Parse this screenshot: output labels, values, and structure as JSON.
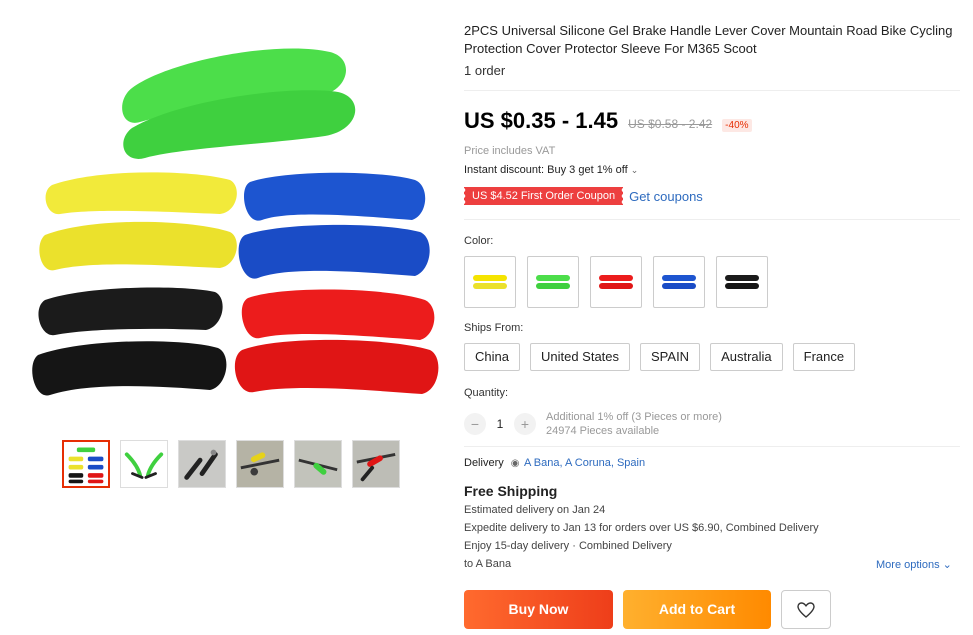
{
  "product": {
    "title": "2PCS Universal Silicone Gel Brake Handle Lever Cover Mountain Road Bike Cycling Protection Cover Protector Sleeve For M365 Scoot",
    "orders": "1 order"
  },
  "pricing": {
    "price": "US $0.35 - 1.45",
    "original_price": "US $0.58 - 2.42",
    "discount": "-40%",
    "vat_note": "Price includes VAT",
    "instant_discount": "Instant discount: Buy 3 get 1% off",
    "coupon_label": "US $4.52 First Order Coupon",
    "get_coupons": "Get coupons"
  },
  "colors": {
    "label": "Color:",
    "options": [
      {
        "name": "yellow",
        "hex": "#f5e400"
      },
      {
        "name": "green",
        "hex": "#3fd84a"
      },
      {
        "name": "red",
        "hex": "#e81e1e"
      },
      {
        "name": "blue",
        "hex": "#1a4fd8"
      },
      {
        "name": "black",
        "hex": "#1a1a1a"
      }
    ]
  },
  "ships_from": {
    "label": "Ships From:",
    "options": [
      "China",
      "United States",
      "SPAIN",
      "Australia",
      "France"
    ]
  },
  "quantity": {
    "label": "Quantity:",
    "minus": "−",
    "value": "1",
    "plus": "+",
    "note_1": "Additional 1% off (3 Pieces or more)",
    "note_2": "24974 Pieces available"
  },
  "delivery": {
    "label": "Delivery",
    "location": "A Bana, A Coruna, Spain",
    "free_shipping": "Free Shipping",
    "estimated": "Estimated delivery on Jan 24",
    "expedite": "Expedite delivery to Jan 13 for orders over US $6.90, Combined Delivery",
    "enjoy": "Enjoy 15-day delivery · Combined Delivery",
    "to": "to A Bana",
    "more_options": "More options"
  },
  "actions": {
    "buy_now": "Buy Now",
    "add_to_cart": "Add to Cart"
  },
  "icons": {
    "wishlist": "heart-icon",
    "location": "pin-icon",
    "chevron": "chevron-down-icon"
  }
}
